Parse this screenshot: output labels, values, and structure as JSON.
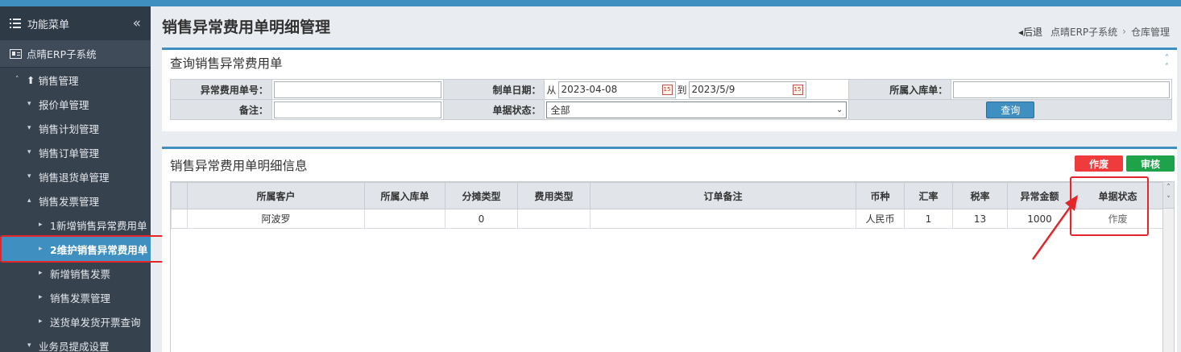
{
  "sidebar": {
    "menu_label": "功能菜单",
    "collapse_icon": "«",
    "system_label": "点晴ERP子系统",
    "items": [
      {
        "label": "销售管理",
        "level": 1,
        "marker": "˄"
      },
      {
        "label": "报价单管理",
        "level": 2,
        "marker": "▾"
      },
      {
        "label": "销售计划管理",
        "level": 2,
        "marker": "▾"
      },
      {
        "label": "销售订单管理",
        "level": 2,
        "marker": "▾"
      },
      {
        "label": "销售退货单管理",
        "level": 2,
        "marker": "▾"
      },
      {
        "label": "销售发票管理",
        "level": 2,
        "marker": "▴"
      },
      {
        "label": "1新增销售异常费用单",
        "level": 3,
        "marker": "▸"
      },
      {
        "label": "2维护销售异常费用单",
        "level": 3,
        "marker": "▸",
        "active": true
      },
      {
        "label": "新增销售发票",
        "level": 3,
        "marker": "▸"
      },
      {
        "label": "销售发票管理",
        "level": 3,
        "marker": "▸"
      },
      {
        "label": "送货单发货开票查询",
        "level": 3,
        "marker": "▸"
      },
      {
        "label": "业务员提成设置",
        "level": 2,
        "marker": "▾"
      }
    ]
  },
  "header": {
    "title": "销售异常费用单明细管理",
    "back_label": "后退",
    "crumb1": "点晴ERP子系统",
    "crumb_sep": "›",
    "crumb2": "仓库管理"
  },
  "query": {
    "title": "查询销售异常费用单",
    "expense_no_label": "异常费用单号：",
    "expense_no_value": "",
    "date_label": "制单日期：",
    "date_from_prefix": "从",
    "date_from": "2023-04-08",
    "date_to_prefix": "到",
    "date_to": "2023/5/9",
    "warehouse_label": "所属入库单：",
    "warehouse_value": "",
    "remark_label": "备注：",
    "remark_value": "",
    "status_label": "单据状态：",
    "status_value": "全部",
    "search_button": "查询"
  },
  "detail": {
    "title": "销售异常费用单明细信息",
    "void_button": "作废",
    "audit_button": "审核",
    "columns": [
      "",
      "所属客户",
      "所属入库单",
      "分摊类型",
      "费用类型",
      "订单备注",
      "币种",
      "汇率",
      "税率",
      "异常金额",
      "单据状态"
    ],
    "rows": [
      [
        "",
        "阿波罗",
        "",
        "0",
        "",
        "",
        "人民币",
        "1",
        "13",
        "1000",
        "作废"
      ]
    ]
  },
  "colors": {
    "accent": "#3f8fc0",
    "sidebar_bg": "#37424f",
    "void": "#ef3b3b",
    "audit": "#1ea34b",
    "highlight": "#e4262a"
  }
}
